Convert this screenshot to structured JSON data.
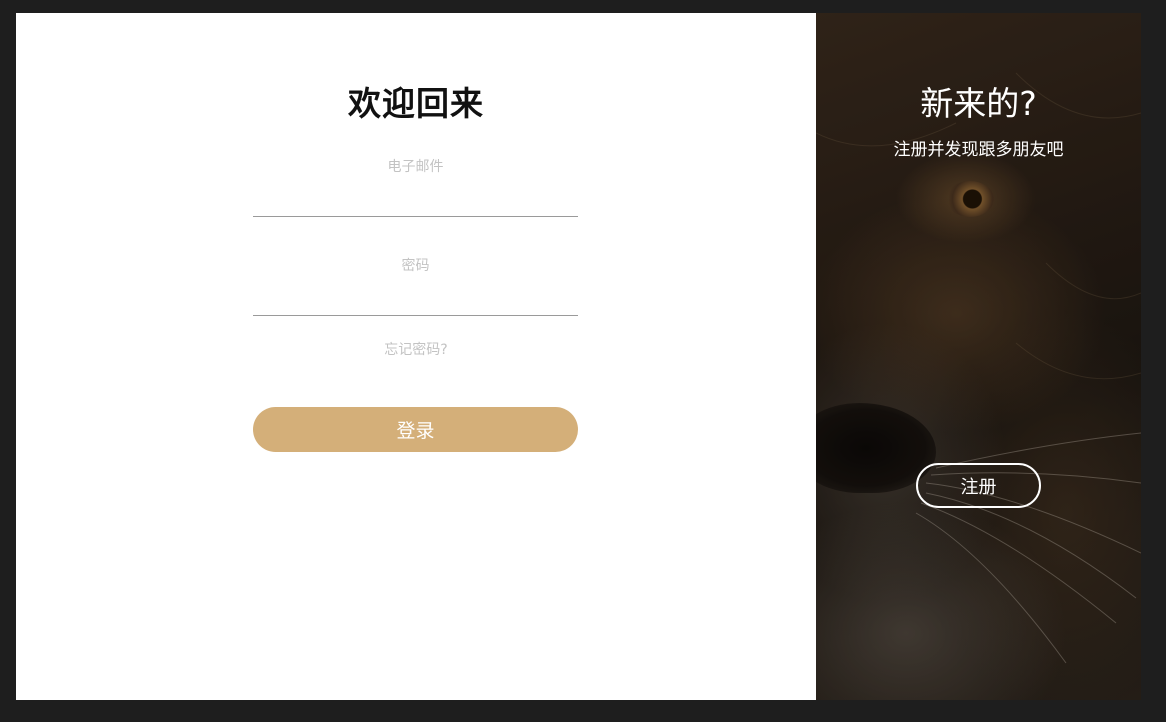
{
  "login": {
    "title": "欢迎回来",
    "email_label": "电子邮件",
    "email_value": "",
    "password_label": "密码",
    "password_value": "",
    "forgot_label": "忘记密码?",
    "submit_label": "登录"
  },
  "signup": {
    "title": "新来的?",
    "subtitle": "注册并发现跟多朋友吧",
    "button_label": "注册"
  },
  "colors": {
    "page_background": "#1e1e1e",
    "accent": "#d4af79",
    "label_gray": "#c3c3c3",
    "underline": "#9a9a9a"
  },
  "icons": {
    "background_image": "lion-face-photo"
  }
}
